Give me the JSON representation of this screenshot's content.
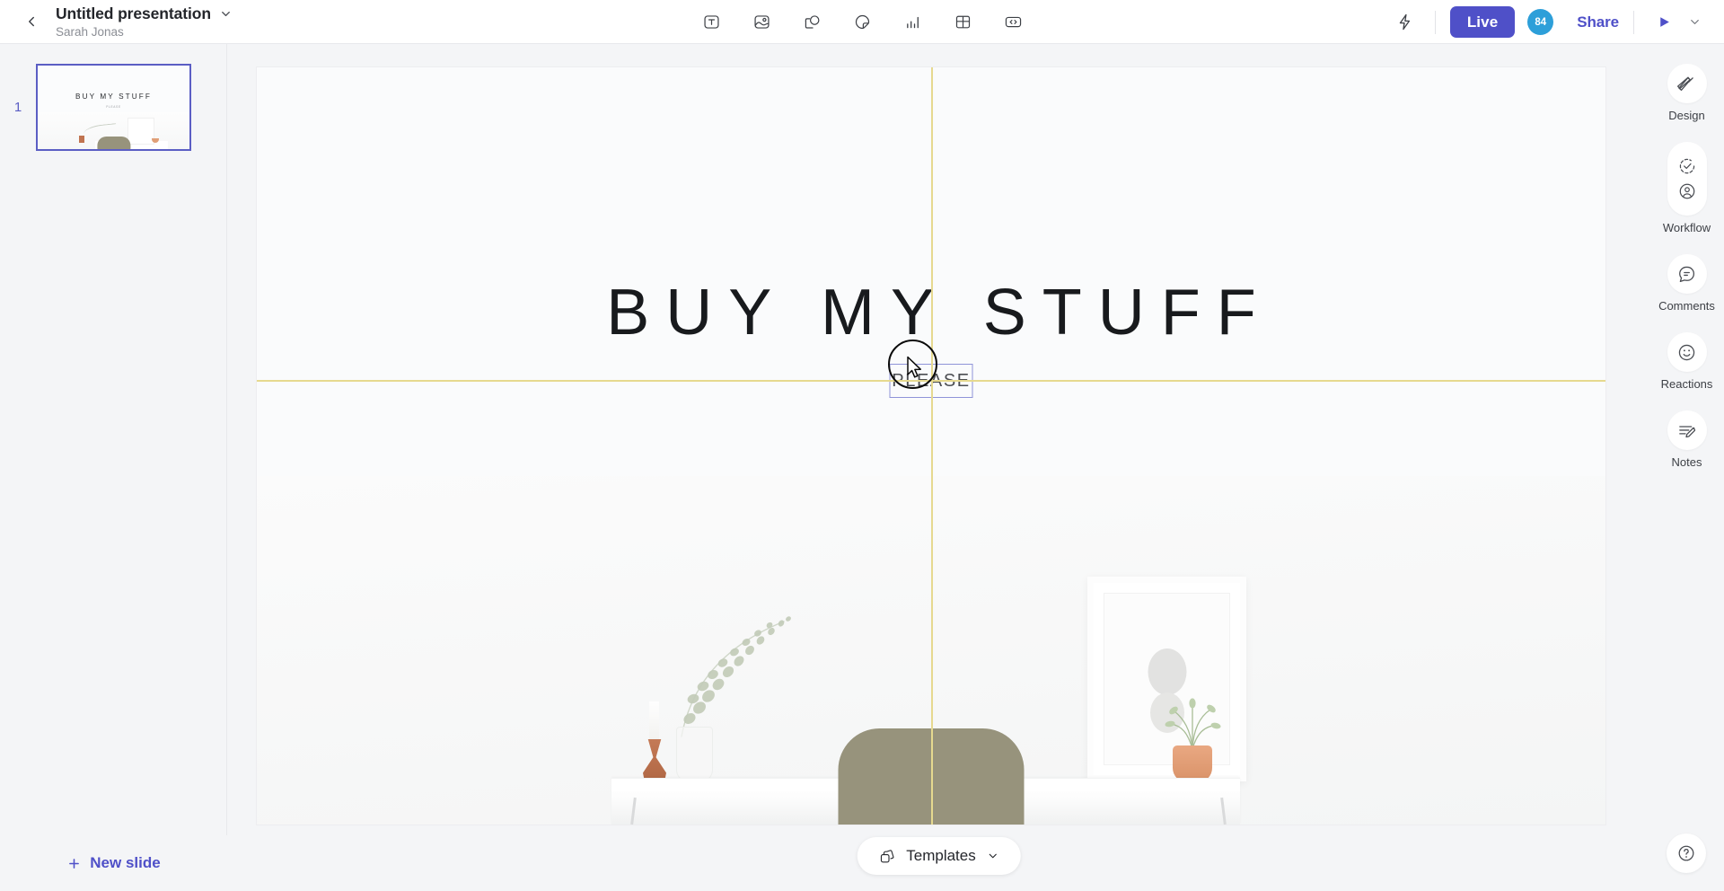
{
  "header": {
    "back_icon": "chevron-left-icon",
    "title": "Untitled presentation",
    "title_caret_icon": "chevron-down-icon",
    "author": "Sarah Jonas",
    "insert_tools": [
      {
        "name": "text-tool",
        "icon": "text-box-icon",
        "label": "T"
      },
      {
        "name": "image-tool",
        "icon": "image-icon",
        "label": "Image"
      },
      {
        "name": "shape-tool",
        "icon": "shape-icon",
        "label": "Shape"
      },
      {
        "name": "sticker-tool",
        "icon": "sticker-icon",
        "label": "Sticker"
      },
      {
        "name": "chart-tool",
        "icon": "chart-bars-icon",
        "label": "Chart"
      },
      {
        "name": "table-tool",
        "icon": "table-grid-icon",
        "label": "Table"
      },
      {
        "name": "embed-tool",
        "icon": "code-embed-icon",
        "label": "Embed"
      }
    ],
    "bolt_icon": "lightning-bolt-icon",
    "live_label": "Live",
    "avatar_count": "84",
    "share_label": "Share",
    "present_icon": "play-triangle-icon",
    "present_caret_icon": "chevron-down-icon"
  },
  "slides_panel": {
    "slides": [
      {
        "number": "1",
        "title": "BUY MY STUFF",
        "subtitle": "PLEASE",
        "selected": true
      }
    ],
    "new_slide_label": "New slide",
    "new_slide_icon": "plus-icon"
  },
  "canvas": {
    "slide": {
      "title": "BUY MY STUFF",
      "selected_text": "PLEASE"
    },
    "guides": {
      "color": "#e6d98f",
      "vertical": true,
      "horizontal": true
    },
    "selection_border_color": "#8f93d8",
    "templates_label": "Templates",
    "templates_icon": "layers-stack-icon",
    "templates_caret_icon": "chevron-down-icon"
  },
  "right_rail": {
    "items": [
      {
        "name": "design",
        "label": "Design",
        "icon": "brush-pencil-cross-icon",
        "tall": false
      },
      {
        "name": "workflow",
        "label": "Workflow",
        "icon": "check-circle-icon",
        "icon2": "person-circle-icon",
        "tall": true
      },
      {
        "name": "comments",
        "label": "Comments",
        "icon": "comment-bubble-icon",
        "tall": false
      },
      {
        "name": "reactions",
        "label": "Reactions",
        "icon": "smiley-face-icon",
        "tall": false
      },
      {
        "name": "notes",
        "label": "Notes",
        "icon": "notes-pencil-icon",
        "tall": false
      }
    ],
    "help_icon": "question-mark-circle-icon"
  },
  "colors": {
    "accent": "#4f50c8",
    "avatar": "#2d9fd9",
    "guide": "#e6d98f",
    "selection": "#8f93d8",
    "app_bg": "#f4f5f7"
  }
}
